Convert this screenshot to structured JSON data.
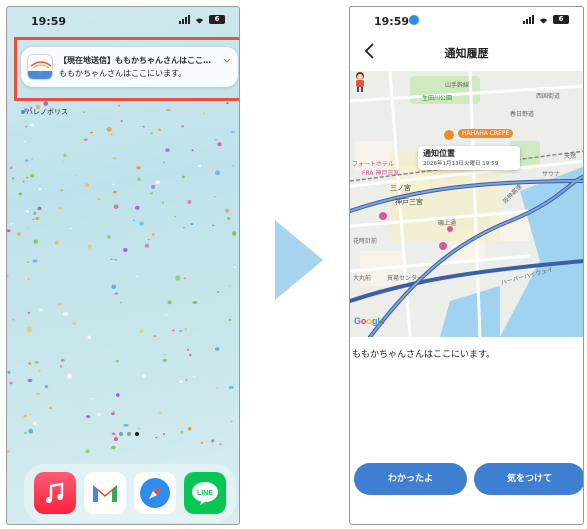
{
  "left_screen": {
    "status_bar": {
      "time": "19:59",
      "battery": "6"
    },
    "notification": {
      "title": "【現在地送信】ももかちゃんさんはここに…",
      "body": "ももかちゃんさんはここにいます。"
    },
    "home_app_label": "ハレノボリス",
    "dock_apps": [
      "music-app",
      "gmail-app",
      "safari-app",
      "line-app"
    ],
    "line_icon_text": "LINE"
  },
  "right_screen": {
    "status_bar": {
      "time": "19:59",
      "battery": "6"
    },
    "nav": {
      "title": "通知履歴",
      "back_label": "‹"
    },
    "map": {
      "callout_title": "通知位置",
      "callout_subtitle": "2026年1月13日火曜日 19:59",
      "labels": {
        "yamate": "山手幹線",
        "ikuta": "生田川公園",
        "kasugano": "春日野道",
        "nishiguchi": "西国街道",
        "hotel1": "フォートホテル",
        "hotel2": "FRA 神戸三宮",
        "sannomiya_jr": "三ノ宮",
        "kobe_sannomiya": "神戸三宮",
        "isogami": "磯上通",
        "hanadokei": "花時計前",
        "daimaru": "大丸前",
        "boeki": "貿易センター",
        "hanshin": "阪神高速",
        "harbor": "ハーバーハイウェイ",
        "tenbochi": "天然",
        "sawa": "サウナ",
        "hahaha": "HAHAHA CREPE"
      },
      "google": "Google"
    },
    "message": "ももかちゃんさんはここにいます。",
    "buttons": {
      "ok": "わかったよ",
      "careful": "気をつけて"
    }
  },
  "colors": {
    "highlight_border": "#e8523a",
    "arrow": "#a9d4f0",
    "button_blue": "#3f7fd1"
  }
}
